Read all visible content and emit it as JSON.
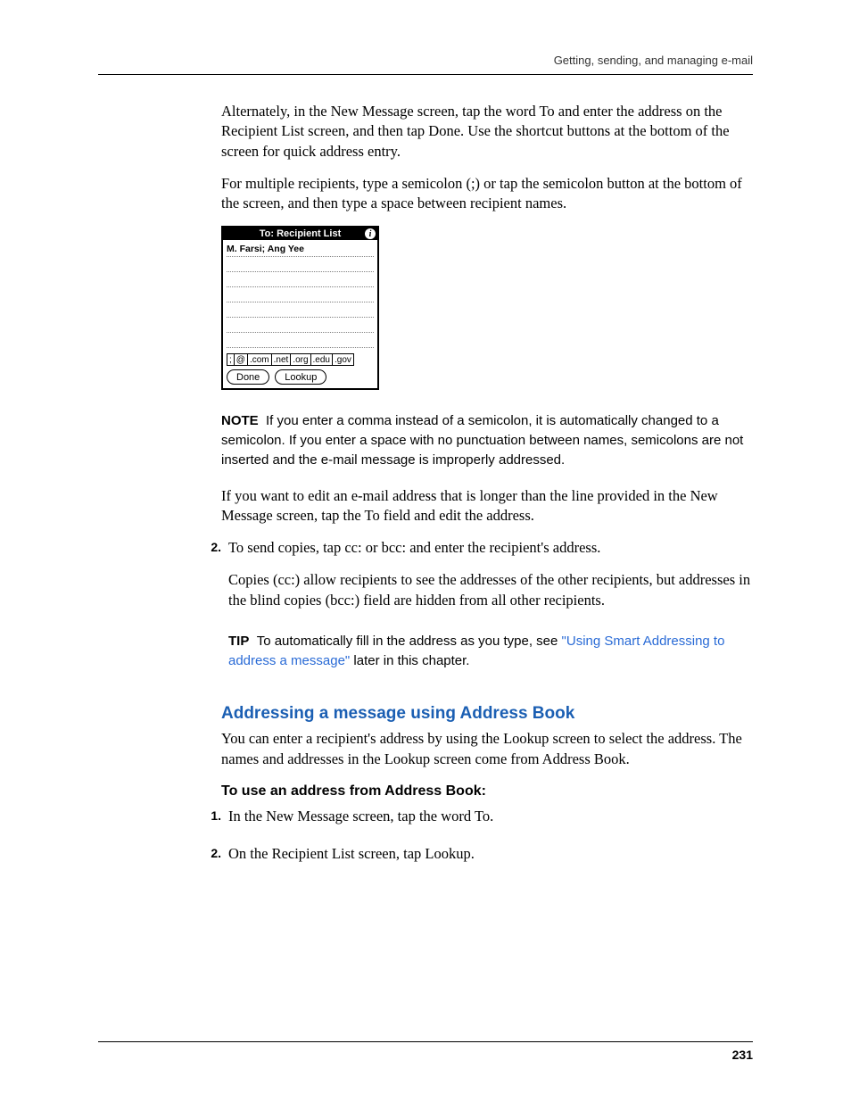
{
  "header": {
    "running": "Getting, sending, and managing e-mail"
  },
  "body": {
    "p1": "Alternately, in the New Message screen, tap the word To and enter the address on the Recipient List screen, and then tap Done. Use the shortcut buttons at the bottom of the screen for quick address entry.",
    "p2": "For multiple recipients, type a semicolon (;) or tap the semicolon button at the bottom of the screen, and then type a space between recipient names."
  },
  "screenshot": {
    "title": "To: Recipient List",
    "info_icon": "i",
    "entry": "M. Farsi; Ang Yee",
    "shortcuts": [
      ";",
      "@",
      ".com",
      ".net",
      ".org",
      ".edu",
      ".gov"
    ],
    "buttons": {
      "done": "Done",
      "lookup": "Lookup"
    }
  },
  "note": {
    "label": "NOTE",
    "text": "If you enter a comma instead of a semicolon, it is automatically changed to a semicolon. If you enter a space with no punctuation between names, semicolons are not inserted and the e-mail message is improperly addressed."
  },
  "p3": "If you want to edit an e-mail address that is longer than the line provided in the New Message screen, tap the To field and edit the address.",
  "step2": {
    "num": "2.",
    "text": "To send copies, tap cc: or bcc: and enter the recipient's address.",
    "detail": "Copies (cc:) allow recipients to see the addresses of the other recipients, but addresses in the blind copies (bcc:) field are hidden from all other recipients."
  },
  "tip": {
    "label": "TIP",
    "before": "To automatically fill in the address as you type, see ",
    "link": "\"Using Smart Addressing to address a message\"",
    "after": " later in this chapter."
  },
  "h3": "Addressing a message using Address Book",
  "p4": "You can enter a recipient's address by using the Lookup screen to select the address. The names and addresses in the Lookup screen come from Address Book.",
  "h4": "To use an address from Address Book:",
  "steps2": {
    "s1num": "1.",
    "s1text": "In the New Message screen, tap the word To.",
    "s2num": "2.",
    "s2text": "On the Recipient List screen, tap Lookup."
  },
  "footer": {
    "page": "231"
  }
}
